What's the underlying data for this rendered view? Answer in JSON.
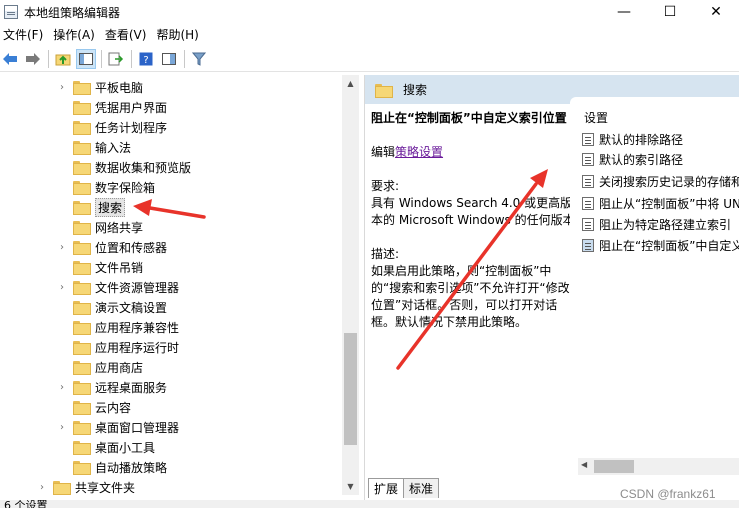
{
  "window": {
    "title": "本地组策略编辑器",
    "minimize_glyph": "—",
    "maximize_glyph": "☐",
    "close_glyph": "✕"
  },
  "menu": [
    "文件(F)",
    "操作(A)",
    "查看(V)",
    "帮助(H)"
  ],
  "toolbar": {
    "icons": [
      "back-arrow-icon",
      "forward-arrow-icon",
      "up-folder-icon",
      "show-hide-tree-icon",
      "export-list-icon",
      "help-icon",
      "properties-icon",
      "filter-icon"
    ]
  },
  "tree": {
    "items": [
      {
        "label": "平板电脑",
        "expandable": true
      },
      {
        "label": "凭据用户界面",
        "expandable": false
      },
      {
        "label": "任务计划程序",
        "expandable": false
      },
      {
        "label": "输入法",
        "expandable": false
      },
      {
        "label": "数据收集和预览版",
        "expandable": false
      },
      {
        "label": "数字保险箱",
        "expandable": false
      },
      {
        "label": "搜索",
        "expandable": false,
        "selected": true
      },
      {
        "label": "网络共享",
        "expandable": false
      },
      {
        "label": "位置和传感器",
        "expandable": true
      },
      {
        "label": "文件吊销",
        "expandable": false
      },
      {
        "label": "文件资源管理器",
        "expandable": true
      },
      {
        "label": "演示文稿设置",
        "expandable": false
      },
      {
        "label": "应用程序兼容性",
        "expandable": false
      },
      {
        "label": "应用程序运行时",
        "expandable": false
      },
      {
        "label": "应用商店",
        "expandable": false
      },
      {
        "label": "远程桌面服务",
        "expandable": true
      },
      {
        "label": "云内容",
        "expandable": false
      },
      {
        "label": "桌面窗口管理器",
        "expandable": true
      },
      {
        "label": "桌面小工具",
        "expandable": false
      },
      {
        "label": "自动播放策略",
        "expandable": false
      }
    ],
    "bottom_item": {
      "label": "共享文件夹",
      "expandable": true
    }
  },
  "right_pane": {
    "header": "搜索",
    "description": {
      "title": "阻止在“控制面板”中自定义索引位置",
      "edit_prefix": "编辑",
      "edit_link": "策略设置",
      "requirement_label": "要求:",
      "requirement_text": "具有 Windows Search 4.0 或更高版本的 Microsoft Windows 的任何版本",
      "description_label": "描述:",
      "description_text": "如果启用此策略，则“控制面板”中的“搜索和索引选项”不允许打开“修改位置”对话框。否则，可以打开对话框。默认情况下禁用此策略。"
    },
    "settings_header": "设置",
    "settings": [
      "默认的排除路径",
      "默认的索引路径",
      "关闭搜索历史记录的存储和",
      "阻止从“控制面板”中将 UN",
      "阻止为特定路径建立索引",
      "阻止在“控制面板”中自定义"
    ],
    "tabs": [
      "扩展",
      "标准"
    ]
  },
  "status_text": "6 个设置",
  "watermark": "CSDN @frankz61",
  "colors": {
    "header_bg": "#d6e4f0",
    "folder": "#f6d776",
    "annotation_arrow": "#e8332a",
    "link": "#6a1b9a"
  }
}
